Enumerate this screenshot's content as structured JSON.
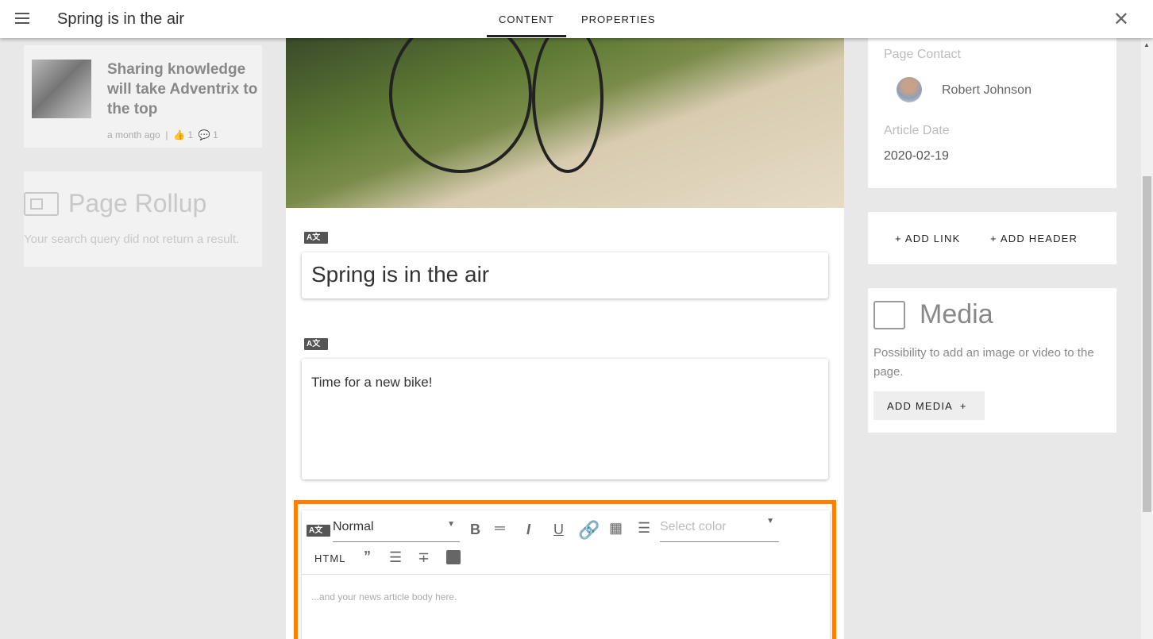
{
  "header": {
    "title": "Spring is in the air",
    "tabs": [
      {
        "label": "CONTENT"
      },
      {
        "label": "PROPERTIES"
      }
    ],
    "active_tab": "CONTENT"
  },
  "left": {
    "news_card": {
      "title": "Sharing knowledge will take Adventrix to the top",
      "time": "a month ago",
      "likes": "1",
      "comments": "1"
    },
    "rollup": {
      "title": "Page Rollup",
      "empty": "Your search query did not return a result."
    }
  },
  "center": {
    "title_value": "Spring is in the air",
    "summary_value": "Time for a new bike!",
    "editor": {
      "format": "Normal",
      "color_placeholder": "Select color",
      "html_label": "HTML",
      "body_placeholder": "...and your news article body here."
    },
    "translate_label": "A文"
  },
  "right": {
    "page_contact_label": "Page Contact",
    "contact_name": "Robert Johnson",
    "article_date_label": "Article Date",
    "article_date": "2020-02-19",
    "add_link": "+ ADD LINK",
    "add_header": "+ ADD HEADER",
    "media": {
      "title": "Media",
      "description": "Possibility to add an image or video to the page.",
      "button": "ADD MEDIA  +"
    }
  },
  "colors": {
    "highlight": "#ff7f00"
  }
}
